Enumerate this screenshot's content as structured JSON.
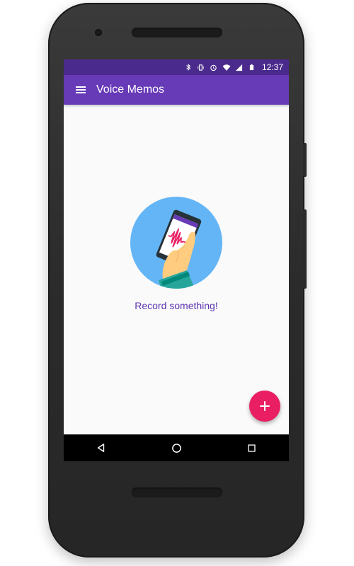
{
  "status_bar": {
    "time": "12:37",
    "icons": [
      "bluetooth-icon",
      "vibrate-icon",
      "alarm-icon",
      "wifi-icon",
      "signal-icon",
      "battery-icon"
    ]
  },
  "app_bar": {
    "title": "Voice Memos",
    "menu_icon": "hamburger-menu-icon",
    "color": "#673ab7",
    "status_color": "#4a2a8c"
  },
  "empty_state": {
    "message": "Record something!",
    "illustration": "phone-recording-illustration",
    "text_color": "#5e35b1"
  },
  "fab": {
    "icon": "plus-icon",
    "color": "#e91e63"
  },
  "nav_bar": {
    "buttons": [
      "back-triangle-icon",
      "home-circle-icon",
      "recents-square-icon"
    ]
  }
}
